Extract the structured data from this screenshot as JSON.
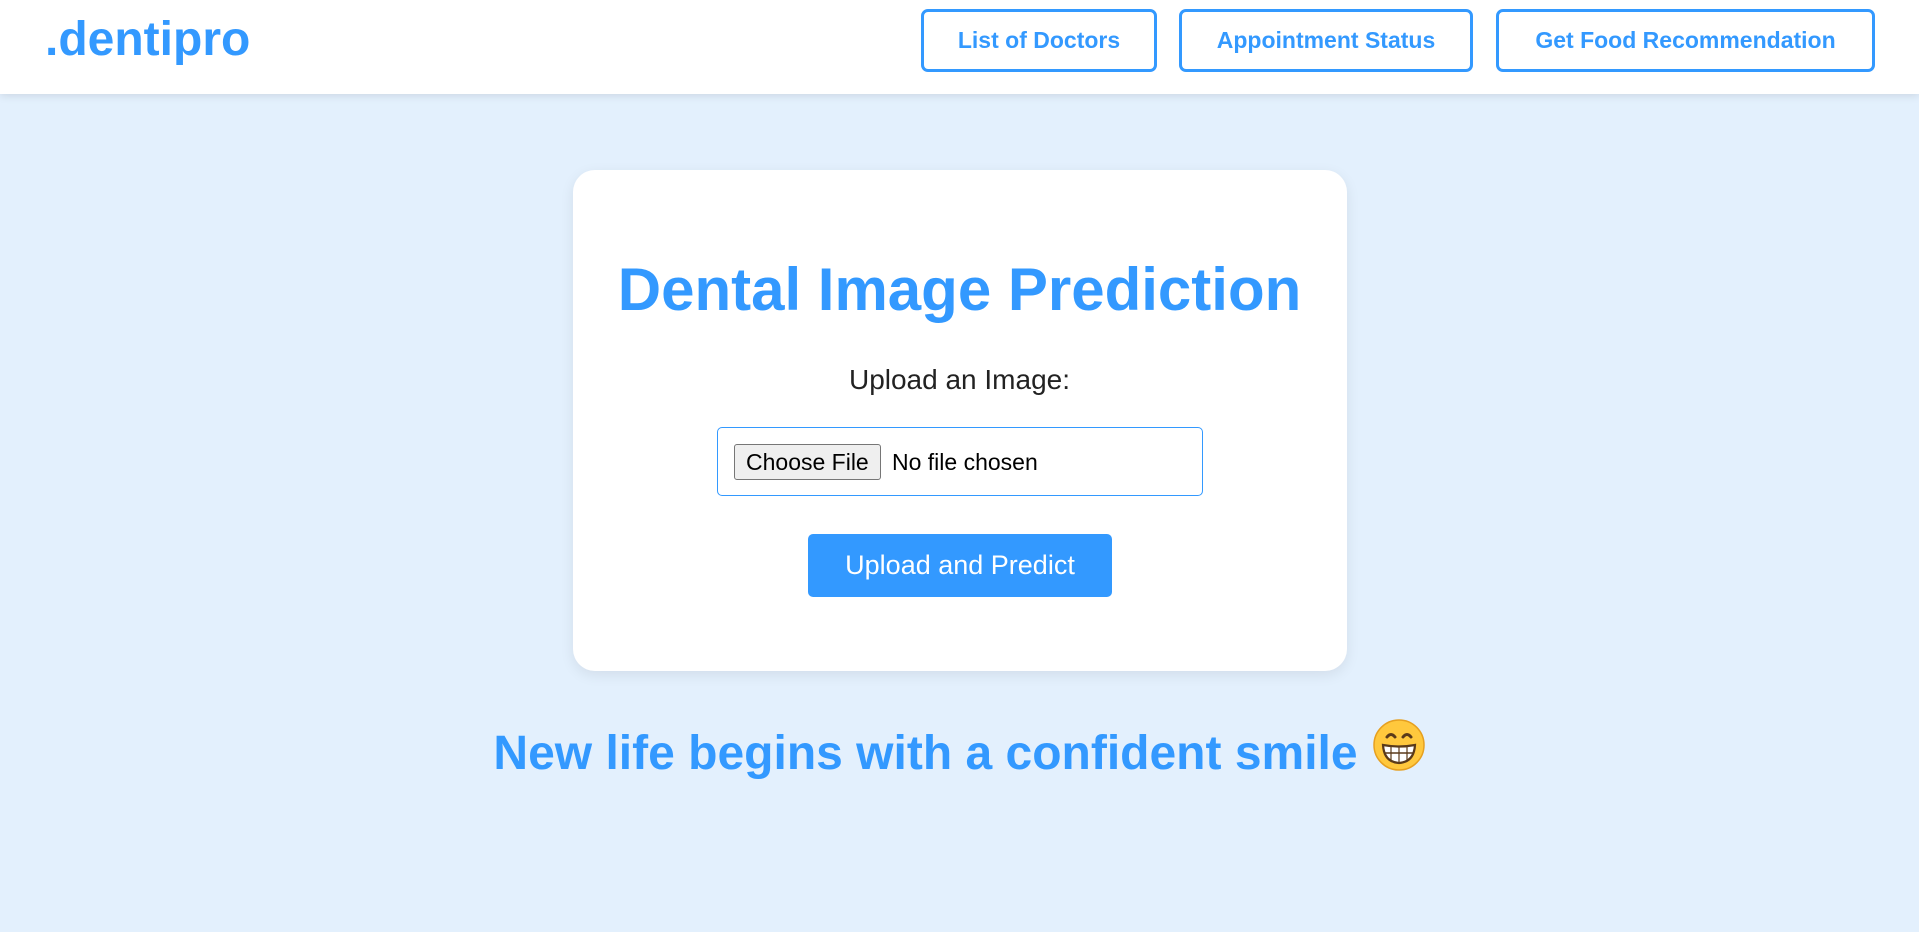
{
  "header": {
    "logo": ".dentipro",
    "nav": {
      "doctors": "List of Doctors",
      "status": "Appointment Status",
      "food": "Get Food Recommendation"
    }
  },
  "main": {
    "title": "Dental Image Prediction",
    "upload_label": "Upload an Image:",
    "file_input": {
      "button_label": "Choose File",
      "status": "No file chosen"
    },
    "submit_label": "Upload and Predict"
  },
  "footer": {
    "tagline": "New life begins with a confident smile",
    "emoji_icon": "grinning-face-icon"
  },
  "colors": {
    "accent": "#3399ff",
    "background": "#e3f0fd",
    "card": "#ffffff"
  }
}
